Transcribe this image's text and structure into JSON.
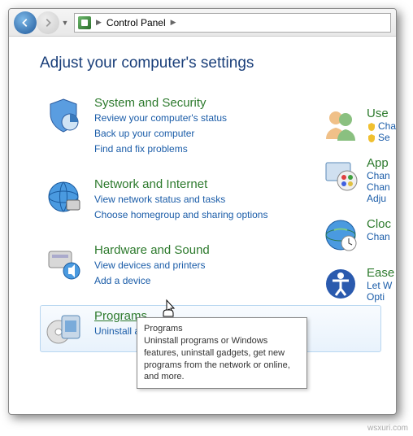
{
  "nav": {
    "breadcrumb": "Control Panel"
  },
  "heading": "Adjust your computer's settings",
  "cats": [
    {
      "title": "System and Security",
      "links": [
        "Review your computer's status",
        "Back up your computer",
        "Find and fix problems"
      ]
    },
    {
      "title": "Network and Internet",
      "links": [
        "View network status and tasks",
        "Choose homegroup and sharing options"
      ]
    },
    {
      "title": "Hardware and Sound",
      "links": [
        "View devices and printers",
        "Add a device"
      ]
    },
    {
      "title": "Programs",
      "links": [
        "Uninstall a program"
      ]
    }
  ],
  "right": [
    {
      "title": "Use",
      "links": [
        "Cha",
        "Se"
      ]
    },
    {
      "title": "App",
      "links": [
        "Chan",
        "Chan",
        "Adju"
      ]
    },
    {
      "title": "Cloc",
      "links": [
        "Chan"
      ]
    },
    {
      "title": "Ease",
      "links": [
        "Let W",
        "Opti"
      ]
    }
  ],
  "tooltip": {
    "title": "Programs",
    "body": "Uninstall programs or Windows features, uninstall gadgets, get new programs from the network or online, and more."
  },
  "watermark": "wsxuri.com"
}
